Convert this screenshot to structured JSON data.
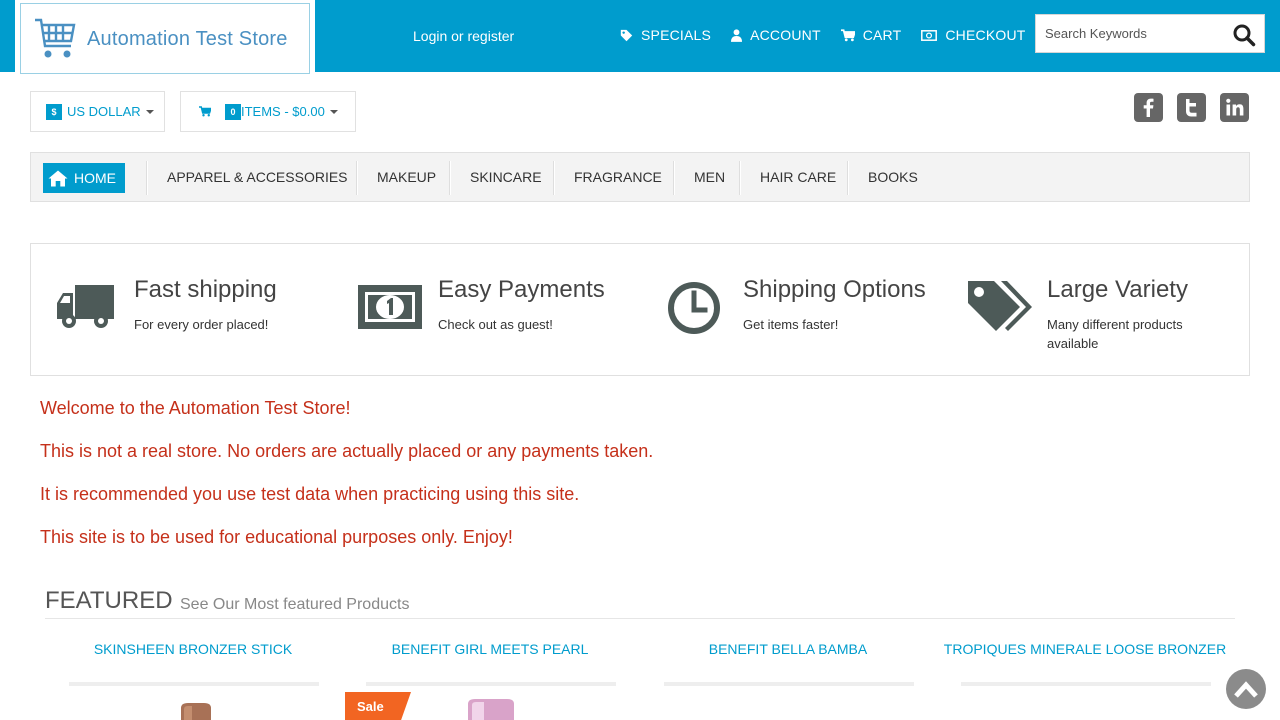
{
  "header": {
    "logo_text": "Automation Test Store",
    "login_link": "Login or register",
    "nav": [
      {
        "label": "SPECIALS",
        "icon": "tag-icon"
      },
      {
        "label": "ACCOUNT",
        "icon": "user-icon"
      },
      {
        "label": "CART",
        "icon": "cart-icon"
      },
      {
        "label": "CHECKOUT",
        "icon": "money-icon"
      }
    ],
    "search_placeholder": "Search Keywords",
    "accent_color": "#009ccd"
  },
  "currency": {
    "badge": "$",
    "label": "US DOLLAR"
  },
  "cart_summary": {
    "count": "0",
    "label": "ITEMS - $0.00"
  },
  "social": [
    "facebook-icon",
    "twitter-icon",
    "linkedin-icon"
  ],
  "categories": {
    "home": "HOME",
    "items": [
      "APPAREL & ACCESSORIES",
      "MAKEUP",
      "SKINCARE",
      "FRAGRANCE",
      "MEN",
      "HAIR CARE",
      "BOOKS"
    ]
  },
  "features": [
    {
      "title": "Fast shipping",
      "subtitle": "For every order placed!",
      "icon": "truck-icon"
    },
    {
      "title": "Easy Payments",
      "subtitle": "Check out as guest!",
      "icon": "money-bill-icon"
    },
    {
      "title": "Shipping Options",
      "subtitle": "Get items faster!",
      "icon": "clock-icon"
    },
    {
      "title": "Large Variety",
      "subtitle": "Many different products available",
      "icon": "tags-icon"
    }
  ],
  "welcome": [
    "Welcome to the Automation Test Store!",
    "This is not a real store. No orders are actually placed or any payments taken.",
    "It is recommended you use test data when practicing using this site.",
    "This site is to be used for educational purposes only. Enjoy!"
  ],
  "featured": {
    "heading": "FEATURED",
    "subheading": "See Our Most featured Products",
    "products": [
      {
        "name": "SKINSHEEN BRONZER STICK"
      },
      {
        "name": "BENEFIT GIRL MEETS PEARL",
        "badge": "Sale"
      },
      {
        "name": "BENEFIT BELLA BAMBA"
      },
      {
        "name": "TROPIQUES MINERALE LOOSE BRONZER"
      }
    ]
  },
  "welcome_color": "#c5301a"
}
